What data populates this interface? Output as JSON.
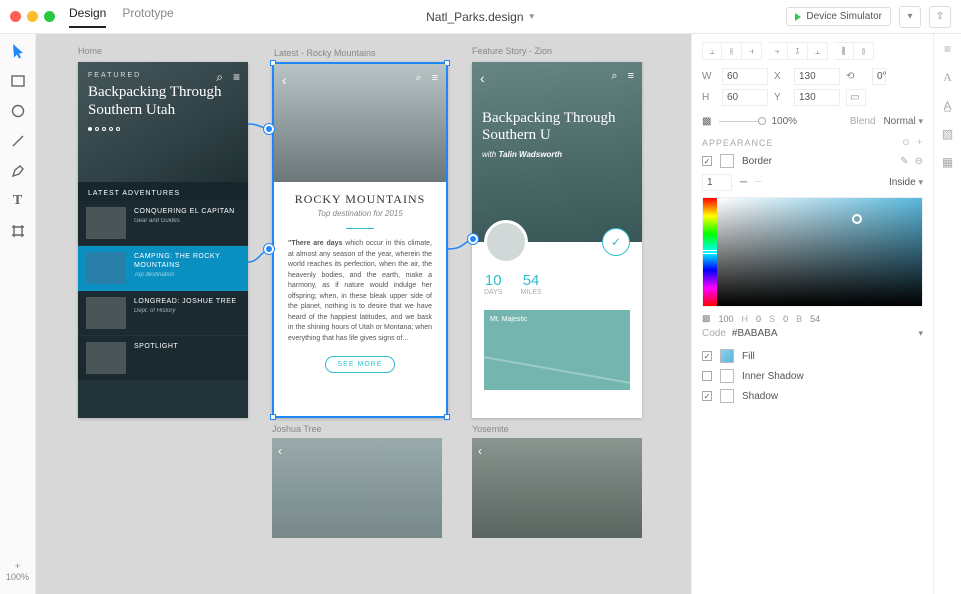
{
  "header": {
    "modes": {
      "design": "Design",
      "prototype": "Prototype"
    },
    "doc_title": "Natl_Parks.design",
    "device_simulator": "Device Simulator"
  },
  "toolbar": {
    "zoom_value": "100%",
    "zoom_plus": "+"
  },
  "canvas": {
    "artboards": {
      "home": {
        "label": "Home",
        "featured": "FEATURED",
        "title": "Backpacking Through Southern Utah",
        "section": "LATEST ADVENTURES",
        "items": [
          {
            "title": "CONQUERING EL CAPITAN",
            "sub": "Gear and Guides"
          },
          {
            "title": "CAMPING: THE ROCKY MOUNTAINS",
            "sub": "Top destination"
          },
          {
            "title": "LONGREAD: JOSHUE TREE",
            "sub": "Dept. of History"
          },
          {
            "title": "SPOTLIGHT",
            "sub": ""
          }
        ]
      },
      "rocky": {
        "label": "Latest - Rocky Mountains",
        "title": "ROCKY MOUNTAINS",
        "subtitle": "Top destination for 2015",
        "body_bold": "\"There are days",
        "body": " which occur in this climate, at almost any season of the year, wherein the world reaches its perfection, when the air, the heavenly bodies, and the earth, make a harmony, as if nature would indulge her offspring; when, in these bleak upper side of the planet, nothing is to desire that we have heard of the happiest latitudes, and we bask in the shining hours of Utah or Montana; when everything that has life gives signs of...",
        "cta": "SEE MORE"
      },
      "zion": {
        "label": "Feature Story - Zion",
        "title": "Backpacking Through Southern U",
        "author_prefix": "with ",
        "author": "Talin Wadsworth",
        "stats": [
          {
            "n": "10",
            "l": "DAYS"
          },
          {
            "n": "54",
            "l": "MILES"
          }
        ],
        "map_label": "Mt. Majestic"
      },
      "joshua": {
        "label": "Joshua Tree"
      },
      "yosemite": {
        "label": "Yosemite"
      }
    }
  },
  "inspector": {
    "dims": {
      "w": "60",
      "x": "130",
      "rot": "0°",
      "h": "60",
      "y": "130"
    },
    "opacity": "100%",
    "blend_label": "Blend",
    "blend_mode": "Normal",
    "appearance_label": "APPEARANCE",
    "border_label": "Border",
    "stroke_width": "1",
    "stroke_pos": "Inside",
    "hsb": {
      "h": "100",
      "h2": "0",
      "s": "0",
      "b": "54"
    },
    "code_label": "Code",
    "code_value": "#BABABA",
    "fill_label": "Fill",
    "inner_shadow_label": "Inner Shadow",
    "shadow_label": "Shadow"
  }
}
